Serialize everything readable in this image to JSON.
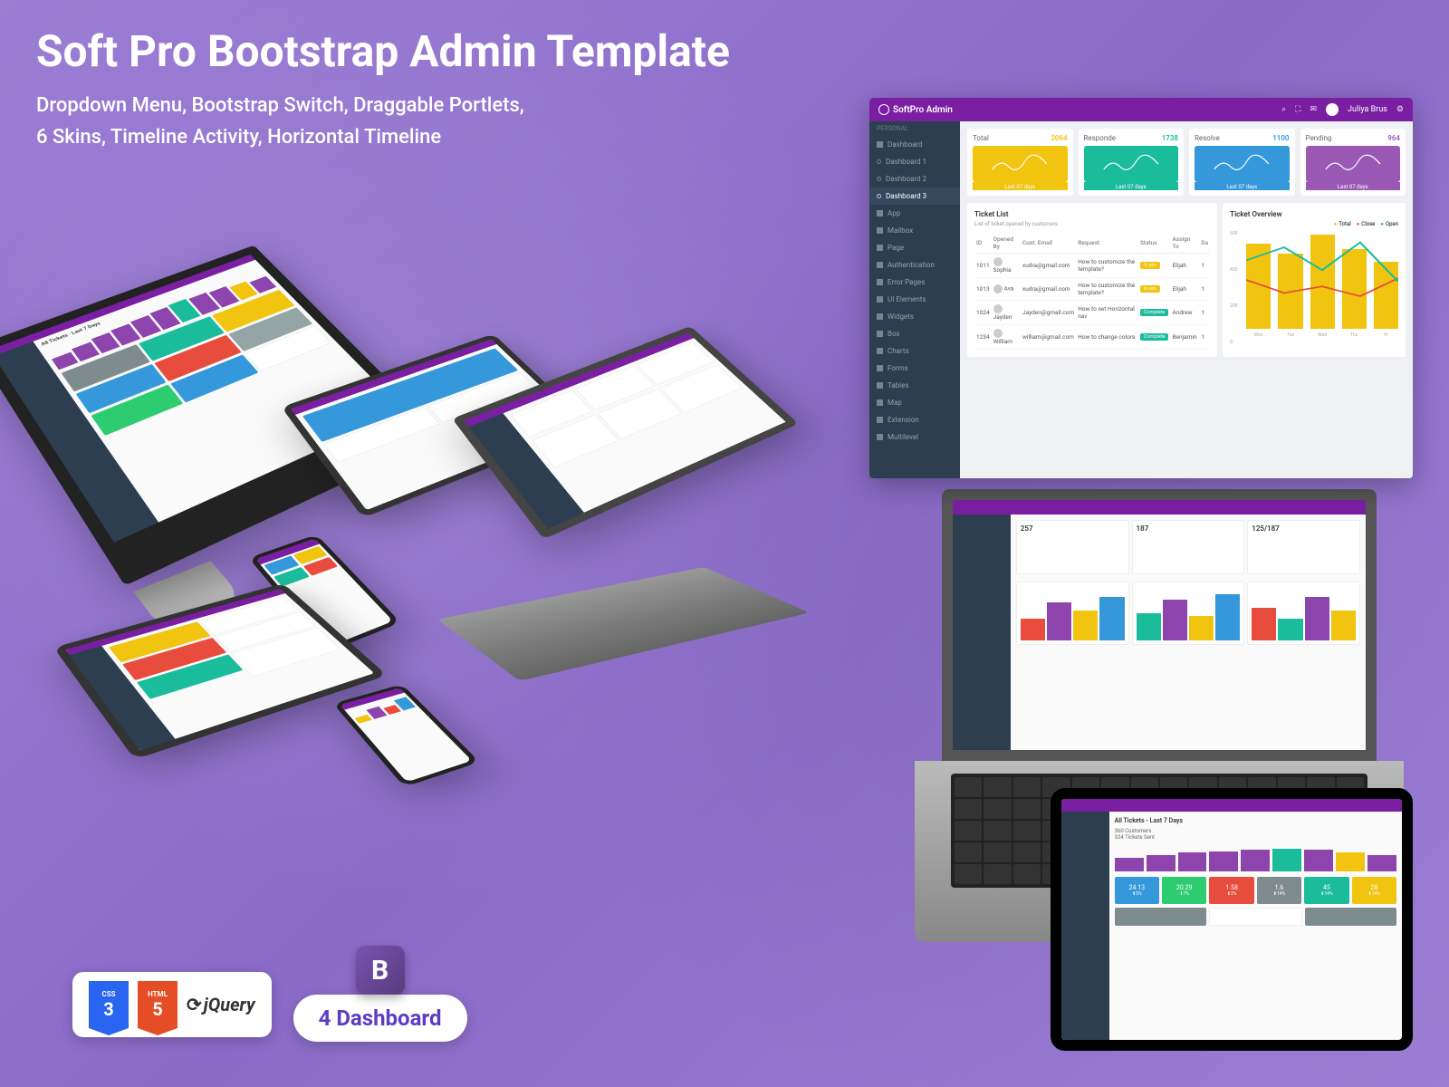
{
  "hero": {
    "title": "Soft Pro Bootstrap Admin Template",
    "subtitle_line1": "Dropdown Menu, Bootstrap Switch, Draggable Portlets,",
    "subtitle_line2": "6 Skins, Timeline Activity, Horizontal Timeline"
  },
  "dashboard": {
    "brand": "SoftPro Admin",
    "user": "Juliya Brus",
    "sidebar": {
      "section": "PERSONAL",
      "items": [
        {
          "label": "Dashboard",
          "active": false
        },
        {
          "label": "Dashboard 1",
          "active": false,
          "sub": true
        },
        {
          "label": "Dashboard 2",
          "active": false,
          "sub": true
        },
        {
          "label": "Dashboard 3",
          "active": true,
          "sub": true
        },
        {
          "label": "App",
          "active": false
        },
        {
          "label": "Mailbox",
          "active": false
        },
        {
          "label": "Page",
          "active": false
        },
        {
          "label": "Authentication",
          "active": false
        },
        {
          "label": "Error Pages",
          "active": false
        },
        {
          "label": "UI Elements",
          "active": false
        },
        {
          "label": "Widgets",
          "active": false
        },
        {
          "label": "Box",
          "active": false
        },
        {
          "label": "Charts",
          "active": false
        },
        {
          "label": "Forms",
          "active": false
        },
        {
          "label": "Tables",
          "active": false
        },
        {
          "label": "Map",
          "active": false
        },
        {
          "label": "Extension",
          "active": false
        },
        {
          "label": "Multilevel",
          "active": false
        }
      ]
    },
    "stats": [
      {
        "label": "Total",
        "value": "2064",
        "color": "#f1c40f",
        "footer": "Last 07 days"
      },
      {
        "label": "Responde",
        "value": "1738",
        "color": "#1abc9c",
        "footer": "Last 07 days"
      },
      {
        "label": "Resolve",
        "value": "1100",
        "color": "#3498db",
        "footer": "Last 07 days"
      },
      {
        "label": "Pending",
        "value": "964",
        "color": "#9b59b6",
        "footer": "Last 07 days"
      }
    ],
    "ticket_list": {
      "title": "Ticket List",
      "subtitle": "List of ticket opened by customers",
      "columns": [
        "ID",
        "Opened By",
        "Cust. Email",
        "Request",
        "Status",
        "Assign To",
        "Da"
      ],
      "rows": [
        {
          "id": "1011",
          "by": "Sophia",
          "email": "xudra@gmail.com",
          "req": "How to customize the template?",
          "status": "prog",
          "status_label": "In pro",
          "assign": "Elijah",
          "da": "1"
        },
        {
          "id": "1013",
          "by": "Ava",
          "email": "xudra@gmail.com",
          "req": "How to customize the template?",
          "status": "prog",
          "status_label": "In pro",
          "assign": "Elijah",
          "da": "1"
        },
        {
          "id": "1024",
          "by": "Jayden",
          "email": "Jayden@gmail.com",
          "req": "How to set Horizontal nav",
          "status": "comp",
          "status_label": "Complete",
          "assign": "Andrew",
          "da": "1"
        },
        {
          "id": "1234",
          "by": "William",
          "email": "william@gmail.com",
          "req": "How to change colors",
          "status": "comp",
          "status_label": "Complete",
          "assign": "Benjamin",
          "da": "1"
        }
      ]
    },
    "overview": {
      "title": "Ticket Overview",
      "legend": {
        "total": "Total",
        "close": "Close",
        "open": "Open"
      }
    }
  },
  "laptop_front": {
    "cards": [
      {
        "label": "257"
      },
      {
        "label": "187"
      },
      {
        "label": "125/187"
      }
    ]
  },
  "tablet_front": {
    "title": "All Tickets - Last 7 Days",
    "stat1": "360 Customers",
    "stat2": "324 Tickets Sent",
    "cards": [
      {
        "val": "24.13",
        "sub": "5%",
        "color": "#3498db"
      },
      {
        "val": "20.29",
        "sub": "7%",
        "color": "#2ecc71"
      },
      {
        "val": "1.58",
        "sub": "3%",
        "color": "#e74c3c"
      },
      {
        "val": "1.6",
        "sub": "14%",
        "color": "#7f8c8d"
      },
      {
        "val": "45",
        "sub": "14%",
        "color": "#1abc9c"
      },
      {
        "val": "28",
        "sub": "14%",
        "color": "#f1c40f"
      }
    ]
  },
  "badges": {
    "css_label": "CSS",
    "css_ver": "3",
    "html_label": "HTML",
    "html_ver": "5",
    "jquery": "jQuery",
    "bootstrap": "B",
    "dashboard_pill": "4 Dashboard"
  },
  "chart_data": {
    "type": "bar",
    "title": "Ticket Overview",
    "categories": [
      "Mon",
      "Tue",
      "Wed",
      "Thu",
      "Fr"
    ],
    "ylim": [
      0,
      600
    ],
    "yticks": [
      600,
      400,
      200,
      0
    ],
    "series": [
      {
        "name": "Total",
        "color": "#f1c40f",
        "values": [
          520,
          460,
          580,
          490,
          410
        ]
      },
      {
        "name": "Close",
        "color": "#e74c3c",
        "values": [
          300,
          220,
          260,
          200,
          310
        ]
      },
      {
        "name": "Open",
        "color": "#1abc9c",
        "values": [
          420,
          500,
          360,
          530,
          290
        ]
      }
    ]
  }
}
